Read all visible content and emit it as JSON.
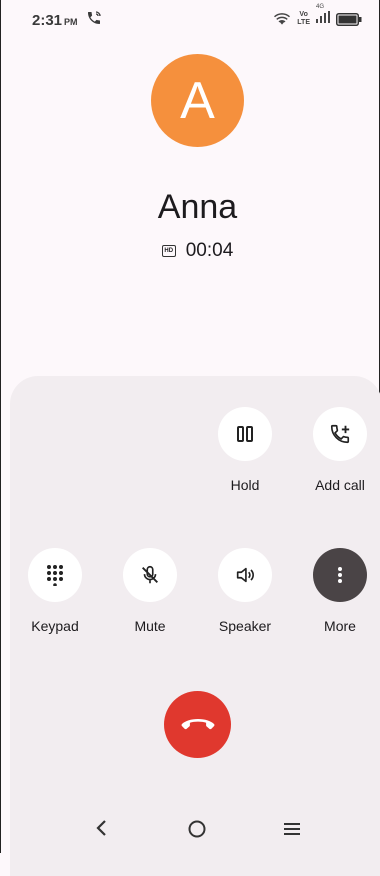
{
  "status_bar": {
    "time": "2:31",
    "ampm": "PM",
    "volte_top": "Vo",
    "volte_bottom": "LTE",
    "signal_label": "4G"
  },
  "contact": {
    "initial": "A",
    "name": "Anna",
    "timer": "00:04",
    "avatar_color": "#f5903d"
  },
  "controls": {
    "hold": "Hold",
    "add_call": "Add call",
    "keypad": "Keypad",
    "mute": "Mute",
    "speaker": "Speaker",
    "more": "More"
  },
  "colors": {
    "end_call": "#e0382e",
    "more_button": "#4a4446"
  }
}
